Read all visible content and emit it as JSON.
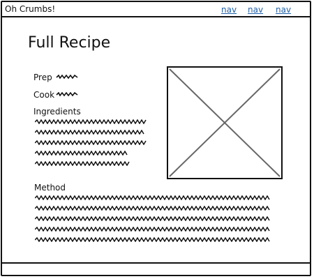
{
  "header": {
    "brand": "Oh Crumbs!",
    "nav": [
      "nav",
      "nav",
      "nav"
    ]
  },
  "recipe": {
    "title": "Full Recipe",
    "prep_label": "Prep",
    "cook_label": "Cook",
    "ingredients_label": "Ingredients",
    "method_label": "Method"
  },
  "icons": {
    "image_placeholder": "image-placeholder-icon"
  }
}
